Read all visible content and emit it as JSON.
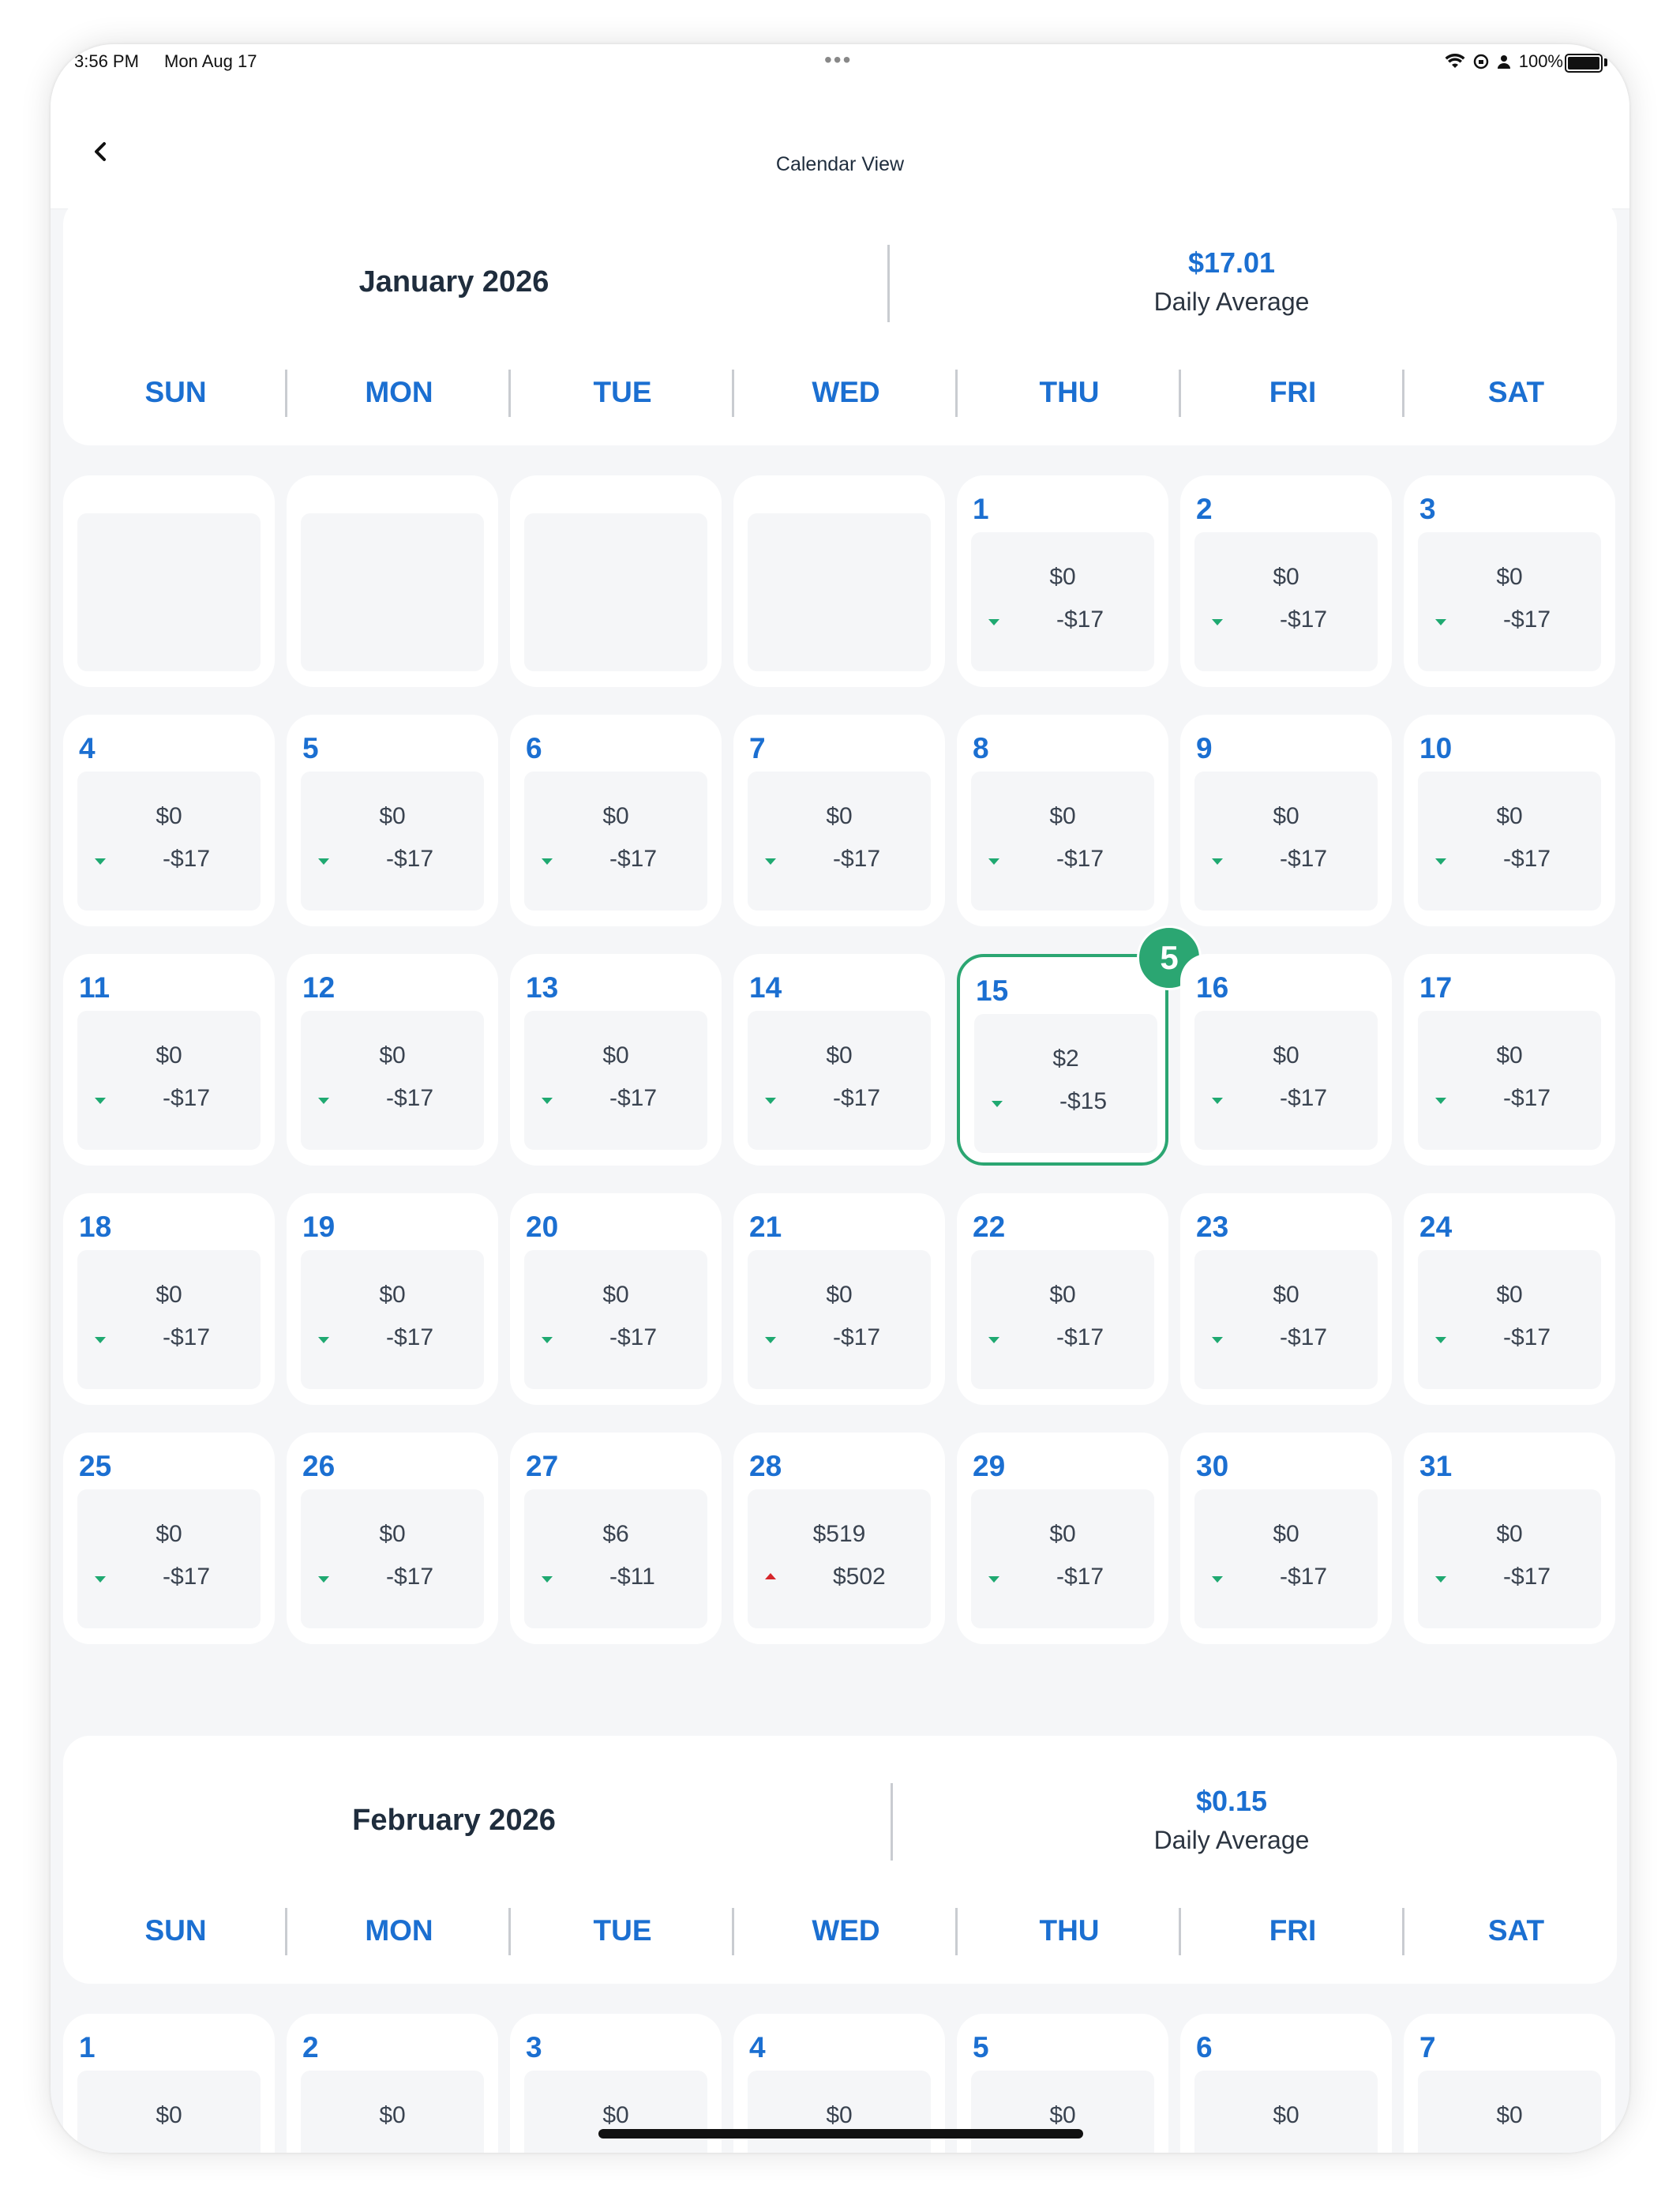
{
  "status_bar": {
    "time": "3:56 PM",
    "date": "Mon Aug 17",
    "dots": "•••",
    "battery_text": "100%"
  },
  "nav": {
    "title": "Calendar View",
    "back_icon": "chevron-left-icon"
  },
  "weekdays": [
    "SUN",
    "MON",
    "TUE",
    "WED",
    "THU",
    "FRI",
    "SAT"
  ],
  "months": [
    {
      "title": "January 2026",
      "daily_average_value": "$17.01",
      "daily_average_label": "Daily Average",
      "leading_blanks": 4,
      "days": [
        {
          "day": "1",
          "value": "$0",
          "diff": "-$17",
          "trend": "down"
        },
        {
          "day": "2",
          "value": "$0",
          "diff": "-$17",
          "trend": "down"
        },
        {
          "day": "3",
          "value": "$0",
          "diff": "-$17",
          "trend": "down"
        },
        {
          "day": "4",
          "value": "$0",
          "diff": "-$17",
          "trend": "down"
        },
        {
          "day": "5",
          "value": "$0",
          "diff": "-$17",
          "trend": "down"
        },
        {
          "day": "6",
          "value": "$0",
          "diff": "-$17",
          "trend": "down"
        },
        {
          "day": "7",
          "value": "$0",
          "diff": "-$17",
          "trend": "down"
        },
        {
          "day": "8",
          "value": "$0",
          "diff": "-$17",
          "trend": "down"
        },
        {
          "day": "9",
          "value": "$0",
          "diff": "-$17",
          "trend": "down"
        },
        {
          "day": "10",
          "value": "$0",
          "diff": "-$17",
          "trend": "down"
        },
        {
          "day": "11",
          "value": "$0",
          "diff": "-$17",
          "trend": "down"
        },
        {
          "day": "12",
          "value": "$0",
          "diff": "-$17",
          "trend": "down"
        },
        {
          "day": "13",
          "value": "$0",
          "diff": "-$17",
          "trend": "down"
        },
        {
          "day": "14",
          "value": "$0",
          "diff": "-$17",
          "trend": "down"
        },
        {
          "day": "15",
          "value": "$2",
          "diff": "-$15",
          "trend": "down",
          "selected": true,
          "badge": "5"
        },
        {
          "day": "16",
          "value": "$0",
          "diff": "-$17",
          "trend": "down"
        },
        {
          "day": "17",
          "value": "$0",
          "diff": "-$17",
          "trend": "down"
        },
        {
          "day": "18",
          "value": "$0",
          "diff": "-$17",
          "trend": "down"
        },
        {
          "day": "19",
          "value": "$0",
          "diff": "-$17",
          "trend": "down"
        },
        {
          "day": "20",
          "value": "$0",
          "diff": "-$17",
          "trend": "down"
        },
        {
          "day": "21",
          "value": "$0",
          "diff": "-$17",
          "trend": "down"
        },
        {
          "day": "22",
          "value": "$0",
          "diff": "-$17",
          "trend": "down"
        },
        {
          "day": "23",
          "value": "$0",
          "diff": "-$17",
          "trend": "down"
        },
        {
          "day": "24",
          "value": "$0",
          "diff": "-$17",
          "trend": "down"
        },
        {
          "day": "25",
          "value": "$0",
          "diff": "-$17",
          "trend": "down"
        },
        {
          "day": "26",
          "value": "$0",
          "diff": "-$17",
          "trend": "down"
        },
        {
          "day": "27",
          "value": "$6",
          "diff": "-$11",
          "trend": "down"
        },
        {
          "day": "28",
          "value": "$519",
          "diff": "$502",
          "trend": "up"
        },
        {
          "day": "29",
          "value": "$0",
          "diff": "-$17",
          "trend": "down"
        },
        {
          "day": "30",
          "value": "$0",
          "diff": "-$17",
          "trend": "down"
        },
        {
          "day": "31",
          "value": "$0",
          "diff": "-$17",
          "trend": "down"
        }
      ]
    },
    {
      "title": "February 2026",
      "daily_average_value": "$0.15",
      "daily_average_label": "Daily Average",
      "leading_blanks": 0,
      "days": [
        {
          "day": "1",
          "value": "$0"
        },
        {
          "day": "2",
          "value": "$0"
        },
        {
          "day": "3",
          "value": "$0"
        },
        {
          "day": "4",
          "value": "$0"
        },
        {
          "day": "5",
          "value": "$0"
        },
        {
          "day": "6",
          "value": "$0"
        },
        {
          "day": "7",
          "value": "$0"
        }
      ]
    }
  ],
  "colors": {
    "accent": "#1b6fd1",
    "down": "#1fa971",
    "up": "#d6262b",
    "selected": "#2ba672"
  }
}
